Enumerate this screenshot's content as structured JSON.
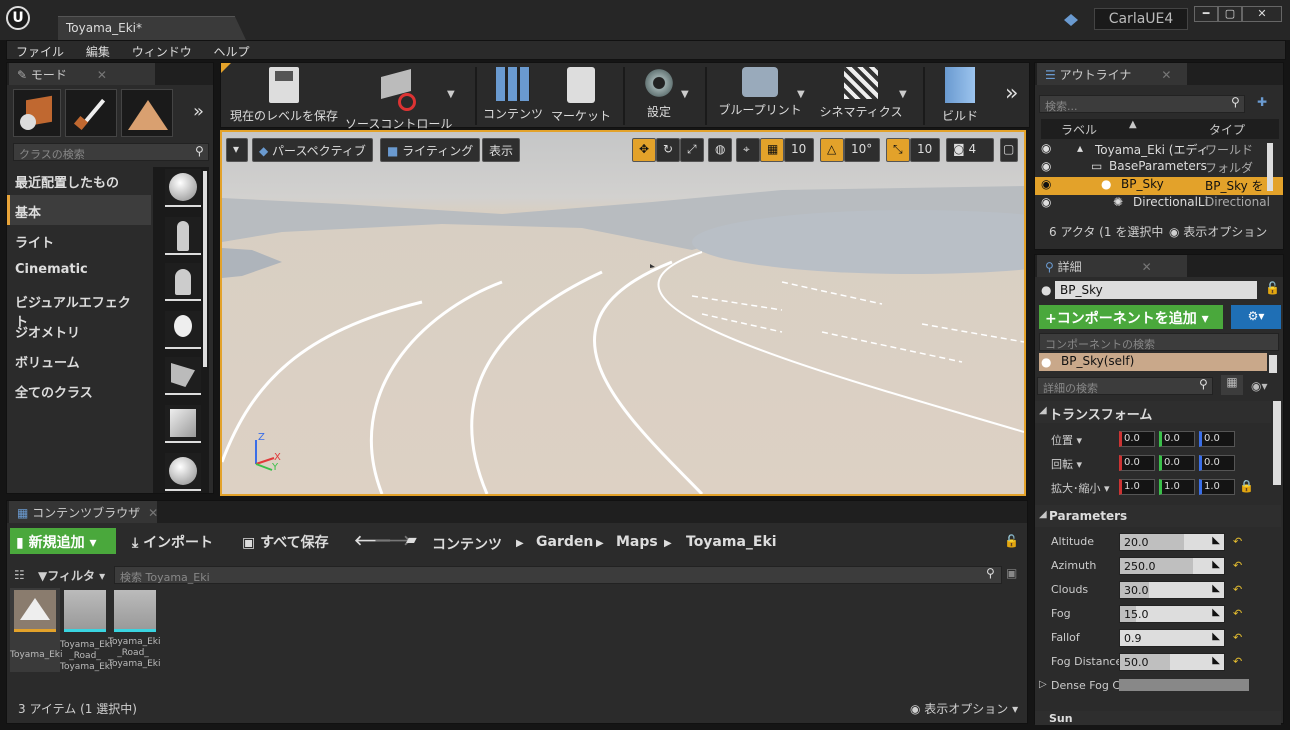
{
  "title_bar": {
    "doc_tab": "Toyama_Eki*",
    "project": "CarlaUE4",
    "logo": "U",
    "win_min": "━",
    "win_max": "▢",
    "win_close": "✕"
  },
  "menu": [
    "ファイル",
    "編集",
    "ウィンドウ",
    "ヘルプ"
  ],
  "modes": {
    "tab_label": "モード",
    "search_placeholder": "クラスの検索",
    "categories": [
      "最近配置したもの",
      "基本",
      "ライト",
      "Cinematic",
      "ビジュアルエフェクト",
      "ジオメトリ",
      "ボリューム",
      "全てのクラス"
    ],
    "selected_category": "基本"
  },
  "toolbar": {
    "buttons": [
      "現在のレベルを保存",
      "ソースコントロール",
      "コンテンツ",
      "マーケット",
      "設定",
      "ブループリント",
      "シネマティクス",
      "ビルド"
    ],
    "overflow": "»"
  },
  "viewport": {
    "perspective": "パースペクティブ",
    "lighting": "ライティング",
    "show": "表示",
    "grid_snap": "10",
    "rot_snap": "10°",
    "scale_snap": "10",
    "camera_speed": "4",
    "axis_z": "Z",
    "axis_x": "X",
    "axis_y": "Y"
  },
  "outliner": {
    "tab_label": "アウトライナ",
    "search_placeholder": "検索...",
    "col_label": "ラベル",
    "col_type": "タイプ",
    "rows": [
      {
        "label": "Toyama_Eki (エディ",
        "type": "ワールド"
      },
      {
        "label": "BaseParameters",
        "type": "フォルダ"
      },
      {
        "label": "BP_Sky",
        "type": "BP_Sky を"
      },
      {
        "label": "DirectionalLi",
        "type": "Directional"
      }
    ],
    "status": "6 アクタ (1 を選択中",
    "view_options": "表示オプション"
  },
  "details": {
    "tab_label": "詳細",
    "name": "BP_Sky",
    "add_component": "+コンポーネントを追加",
    "component_search": "コンポーネントの検索",
    "self_component": "BP_Sky(self)",
    "details_search": "詳細の検索",
    "transform_header": "トランスフォーム",
    "transform": [
      {
        "label": "位置",
        "values": [
          "0.0",
          "0.0",
          "0.0"
        ]
      },
      {
        "label": "回転",
        "values": [
          "0.0",
          "0.0",
          "0.0"
        ]
      },
      {
        "label": "拡大･縮小",
        "values": [
          "1.0",
          "1.0",
          "1.0"
        ]
      }
    ],
    "parameters_header": "Parameters",
    "parameters": [
      {
        "label": "Altitude",
        "value": "20.0",
        "fill": 0.62
      },
      {
        "label": "Azimuth",
        "value": "250.0",
        "fill": 0.7
      },
      {
        "label": "Clouds",
        "value": "30.0",
        "fill": 0.28
      },
      {
        "label": "Fog",
        "value": "15.0",
        "fill": 0.15
      },
      {
        "label": "Fallof",
        "value": "0.9",
        "fill": 0.0
      },
      {
        "label": "Fog Distance",
        "value": "50.0",
        "fill": 0.48
      }
    ],
    "dense_fog": "Dense Fog C",
    "sun_header": "Sun"
  },
  "content_browser": {
    "tab_label": "コンテンツブラウザ",
    "add_new": "新規追加",
    "import": "インポート",
    "save_all": "すべて保存",
    "breadcrumb": [
      "コンテンツ",
      "Garden",
      "Maps",
      "Toyama_Eki"
    ],
    "filter": "フィルタ",
    "search_placeholder": "検索 Toyama_Eki",
    "assets": [
      {
        "name": "Toyama_Eki"
      },
      {
        "name": "Toyama_Eki _Road_ Toyama_Eki"
      },
      {
        "name": "Toyama_Eki _Road_ Toyama_Eki"
      }
    ],
    "item_count": "3 アイテム (1 選択中)",
    "view_options": "表示オプション"
  },
  "colors": {
    "accent": "#e3a22a",
    "green_button": "#4aa83c",
    "blue_button": "#1f6fb5"
  }
}
